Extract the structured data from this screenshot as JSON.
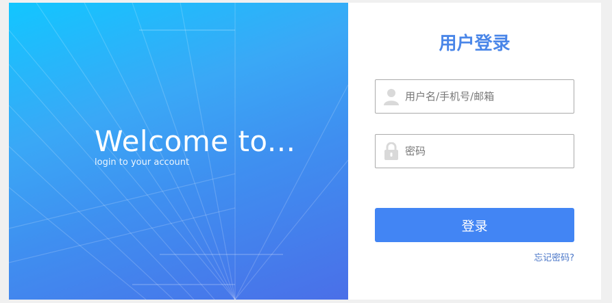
{
  "hero": {
    "welcome": "Welcome  to...",
    "subtitle": "login to your account"
  },
  "form": {
    "title": "用户登录",
    "username_placeholder": "用户名/手机号/邮箱",
    "username_value": "",
    "password_placeholder": "密码",
    "password_value": "",
    "login_label": "登录",
    "forgot_label": "忘记密码?"
  },
  "icons": {
    "username": "user-icon",
    "password": "lock-icon"
  },
  "colors": {
    "accent": "#4285f4",
    "title": "#4a86e8",
    "link": "#4a76c8"
  }
}
